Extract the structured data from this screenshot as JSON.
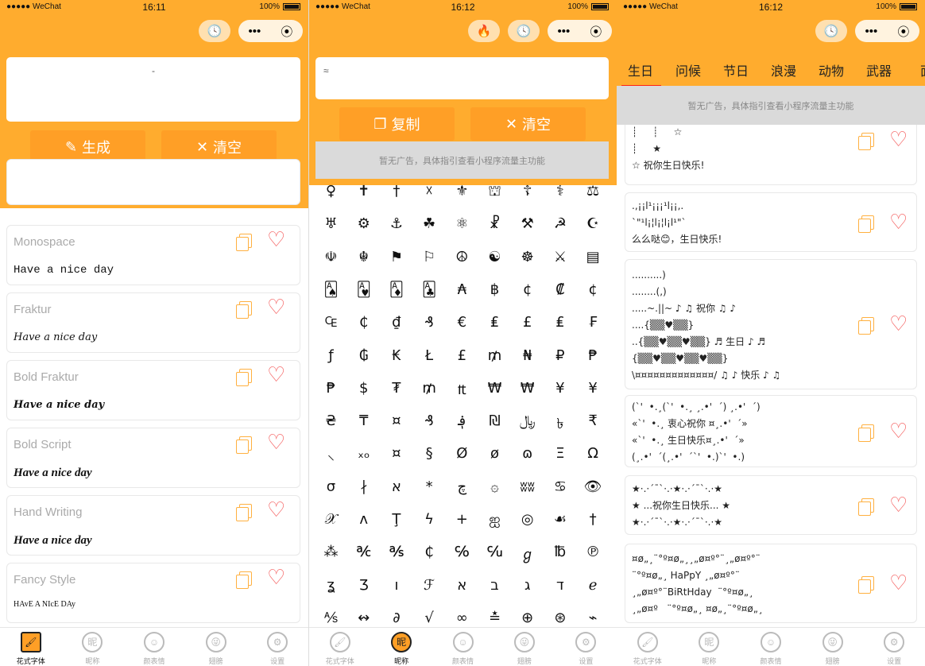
{
  "colors": {
    "primary": "#FFAC2E",
    "button": "#FF9F26",
    "heart": "#F45B5B",
    "tab_underline": "#FF2211"
  },
  "status": [
    {
      "carrier": "●●●●● WeChat",
      "time": "16:11",
      "battery": "100%"
    },
    {
      "carrier": "●●●●● WeChat",
      "time": "16:12",
      "battery": "100%"
    },
    {
      "carrier": "●●●●● WeChat",
      "time": "16:12",
      "battery": "100%"
    }
  ],
  "nav": {
    "more": "•••",
    "target": "⦿",
    "clock": "🕓",
    "fire": "🔥"
  },
  "ad_text": "暂无广告，具体指引查看小程序流量主功能",
  "font_screen": {
    "input_value": "-",
    "generate": "生成",
    "clear": "清空",
    "generate_icon": "magic-wand-icon",
    "styles": [
      {
        "name": "Monospace",
        "sample": "Have a nice day"
      },
      {
        "name": "Fraktur",
        "sample": "Have a nice day"
      },
      {
        "name": "Bold Fraktur",
        "sample": "Have a nice day"
      },
      {
        "name": "Bold Script",
        "sample": "Have a nice day"
      },
      {
        "name": "Hand Writing",
        "sample": "Have a nice day"
      },
      {
        "name": "Fancy Style",
        "sample": "HAvE A NIcE DAy"
      }
    ]
  },
  "nickname_screen": {
    "input_value": "≈",
    "copy": "复制",
    "clear": "清空",
    "symbols": [
      [
        "♀",
        "✝",
        "†",
        "☓",
        "⚜",
        "⛫",
        "☦",
        "⚕",
        "⚖"
      ],
      [
        "♅",
        "⚙",
        "⚓",
        "☘",
        "⚛",
        "☧",
        "⚒",
        "☭",
        "☪"
      ],
      [
        "☫",
        "☬",
        "⚑",
        "⚐",
        "☮",
        "☯",
        "☸",
        "⚔",
        "▤"
      ],
      [
        "🂡",
        "🂱",
        "🃁",
        "🃑",
        "₳",
        "฿",
        "¢",
        "₡",
        "¢"
      ],
      [
        "₠",
        "₵",
        "₫",
        "₰",
        "€",
        "₤",
        "£",
        "₤",
        "₣"
      ],
      [
        "ƒ",
        "₲",
        "₭",
        "Ł",
        "£",
        "₥",
        "₦",
        "₽",
        "₱"
      ],
      [
        "₱",
        "$",
        "₮",
        "₥",
        "₶",
        "₩",
        "₩",
        "¥",
        "¥"
      ],
      [
        "₴",
        "₸",
        "¤",
        "₰",
        "؋",
        "₪",
        "﷼",
        "৳",
        "₹"
      ],
      [
        "⸜",
        "ₓₒ",
        "¤",
        "§",
        "Ø",
        "ø",
        "ɷ",
        "Ξ",
        "Ω"
      ],
      [
        "σ",
        "∤",
        "א",
        "*",
        "چ",
        "۞",
        "ʬʬ",
        "♋",
        "👁"
      ],
      [
        "𝒳",
        "ʌ",
        "Ţ",
        "ϟ",
        "+",
        "ஐ",
        "◎",
        "☙",
        "†"
      ],
      [
        "⁂",
        "℀",
        "℁",
        "₵",
        "℅",
        "℆",
        "ℊ",
        "℔",
        "℗"
      ],
      [
        "ʓ",
        "Ʒ",
        "ו",
        "ℱ",
        "א",
        "ב",
        "ג",
        "ד",
        "ℯ"
      ],
      [
        "⅍",
        "↭",
        "∂",
        "√",
        "∞",
        "≛",
        "⊕",
        "⊛",
        "⌁"
      ]
    ]
  },
  "kaomoji_screen": {
    "tabs": [
      "生日",
      "问候",
      "节日",
      "浪漫",
      "动物",
      "武器",
      "面"
    ],
    "items": [
      {
        "lines": [
          "┊     ┊     ┊     ★",
          "┊     ┊     ☆",
          "┊     ★",
          "☆ 祝你生日快乐!"
        ]
      },
      {
        "lines": [
          ".,¡¡l¹¡¡¡¹l¡¡,.",
          "`\"¹l¡¦l¡¦l¡l¹\"`",
          "么么哒😊，生日快乐!"
        ]
      },
      {
        "lines": [
          "..........)",
          "........(,)",
          ".....~.||~ ♪ ♫ 祝你 ♫ ♪",
          "....{▒▒♥▒▒}",
          "..{▒▒♥▒▒♥▒▒} ♬ 生日 ♪ ♬",
          "{▒▒♥▒▒♥▒▒♥▒▒}",
          "\\¤¤¤¤¤¤¤¤¤¤¤¤¤/ ♫ ♪ 快乐 ♪ ♫"
        ]
      },
      {
        "lines": [
          "(`'  •.¸(`'  •.¸ ¸.•'  ´) ¸.•'  ´)",
          "«`'  •.¸ 衷心祝你 ¤¸.•'  ´»",
          "«`'  •.¸ 生日快乐¤¸.•'  ´»",
          "(¸.•'  ´(¸.•'  ´`'  •.)`'  •.)"
        ]
      },
      {
        "lines": [
          "★·.·´¯`·.·★·.·´¯`·.·★",
          "★ ...祝你生日快乐... ★",
          "★·.·´¯`·.·★·.·´¯`·.·★"
        ]
      },
      {
        "lines": [
          "¤ø„¸¨°º¤ø„¸¸„ø¤º°¨¸„ø¤º°¨",
          "¨°º¤ø„¸ HaPpY ¸„ø¤º°¨",
          "¸„ø¤º°¨BiRtHday  ¨°º¤ø„¸",
          "¸„ø¤º   ¨°º¤ø„¸ ¤ø„¸¨°º¤ø„¸"
        ]
      }
    ]
  },
  "tabbar": [
    {
      "label": "花式字体",
      "icon": "brush-icon",
      "glyph": "🖌"
    },
    {
      "label": "昵称",
      "icon": "nickname-icon",
      "glyph": "昵"
    },
    {
      "label": "颜表情",
      "icon": "smile-icon",
      "glyph": "☺"
    },
    {
      "label": "翅膀",
      "icon": "wink-icon",
      "glyph": "😜"
    },
    {
      "label": "设置",
      "icon": "gear-icon",
      "glyph": "⚙"
    }
  ]
}
